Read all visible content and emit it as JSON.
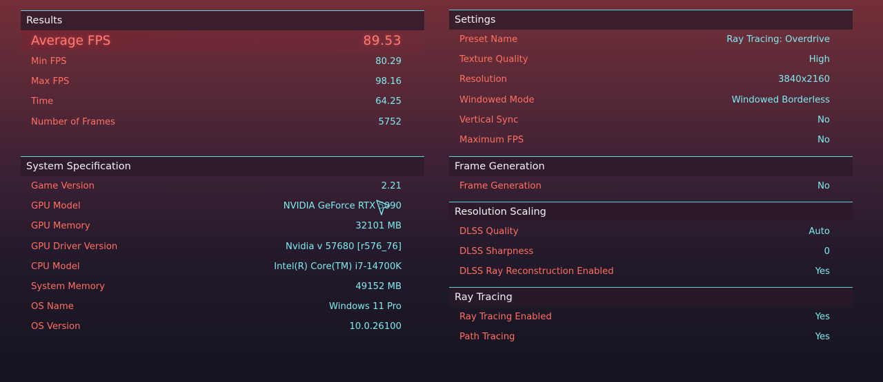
{
  "results": {
    "title": "Results",
    "highlight": {
      "label": "Average FPS",
      "value": "89.53"
    },
    "rows": [
      {
        "label": "Min FPS",
        "value": "80.29"
      },
      {
        "label": "Max FPS",
        "value": "98.16"
      },
      {
        "label": "Time",
        "value": "64.25"
      },
      {
        "label": "Number of Frames",
        "value": "5752"
      }
    ]
  },
  "system": {
    "title": "System Specification",
    "rows": [
      {
        "label": "Game Version",
        "value": "2.21"
      },
      {
        "label": "GPU Model",
        "value": "NVIDIA GeForce RTX 5090"
      },
      {
        "label": "GPU Memory",
        "value": "32101 MB"
      },
      {
        "label": "GPU Driver Version",
        "value": "Nvidia v 57680 [r576_76]"
      },
      {
        "label": "CPU Model",
        "value": "Intel(R) Core(TM) i7-14700K"
      },
      {
        "label": "System Memory",
        "value": "49152 MB"
      },
      {
        "label": "OS Name",
        "value": "Windows 11 Pro"
      },
      {
        "label": "OS Version",
        "value": "10.0.26100"
      }
    ]
  },
  "settings": {
    "title": "Settings",
    "rows": [
      {
        "label": "Preset Name",
        "value": "Ray Tracing: Overdrive"
      },
      {
        "label": "Texture Quality",
        "value": "High"
      },
      {
        "label": "Resolution",
        "value": "3840x2160"
      },
      {
        "label": "Windowed Mode",
        "value": "Windowed Borderless"
      },
      {
        "label": "Vertical Sync",
        "value": "No"
      },
      {
        "label": "Maximum FPS",
        "value": "No"
      }
    ]
  },
  "frame_generation": {
    "title": "Frame Generation",
    "rows": [
      {
        "label": "Frame Generation",
        "value": "No"
      }
    ]
  },
  "resolution_scaling": {
    "title": "Resolution Scaling",
    "rows": [
      {
        "label": "DLSS Quality",
        "value": "Auto"
      },
      {
        "label": "DLSS Sharpness",
        "value": "0"
      },
      {
        "label": "DLSS Ray Reconstruction Enabled",
        "value": "Yes"
      }
    ]
  },
  "ray_tracing": {
    "title": "Ray Tracing",
    "rows": [
      {
        "label": "Ray Tracing Enabled",
        "value": "Yes"
      },
      {
        "label": "Path Tracing",
        "value": "Yes"
      }
    ]
  },
  "colors": {
    "accent_line": "#5fd6dd",
    "label": "#ff6f62",
    "value": "#7fe9ef"
  },
  "icons": {
    "pointer": "mouse-cursor-icon"
  }
}
